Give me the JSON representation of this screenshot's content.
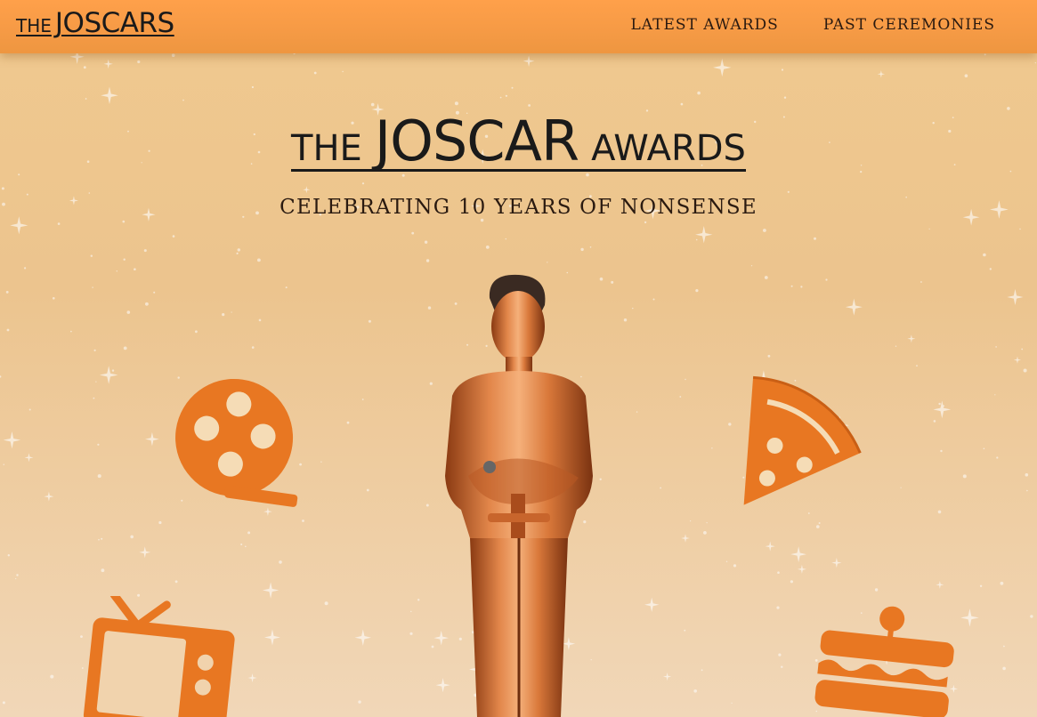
{
  "nav": {
    "logo_small": "THE",
    "logo_big": "JOSCARS",
    "links": [
      "LATEST AWARDS",
      "PAST CEREMONIES"
    ]
  },
  "hero": {
    "title_small": "THE",
    "title_big": "JOSCAR",
    "title_tail": "AWARDS",
    "subtitle": "CELEBRATING 10 YEARS OF NONSENSE"
  },
  "icons": [
    "film-reel-icon",
    "pizza-slice-icon",
    "tv-icon",
    "sandwich-icon"
  ],
  "colors": {
    "nav_bg": "#f59a45",
    "accent_orange": "#e87722",
    "statue_gold": "#d9783a"
  }
}
